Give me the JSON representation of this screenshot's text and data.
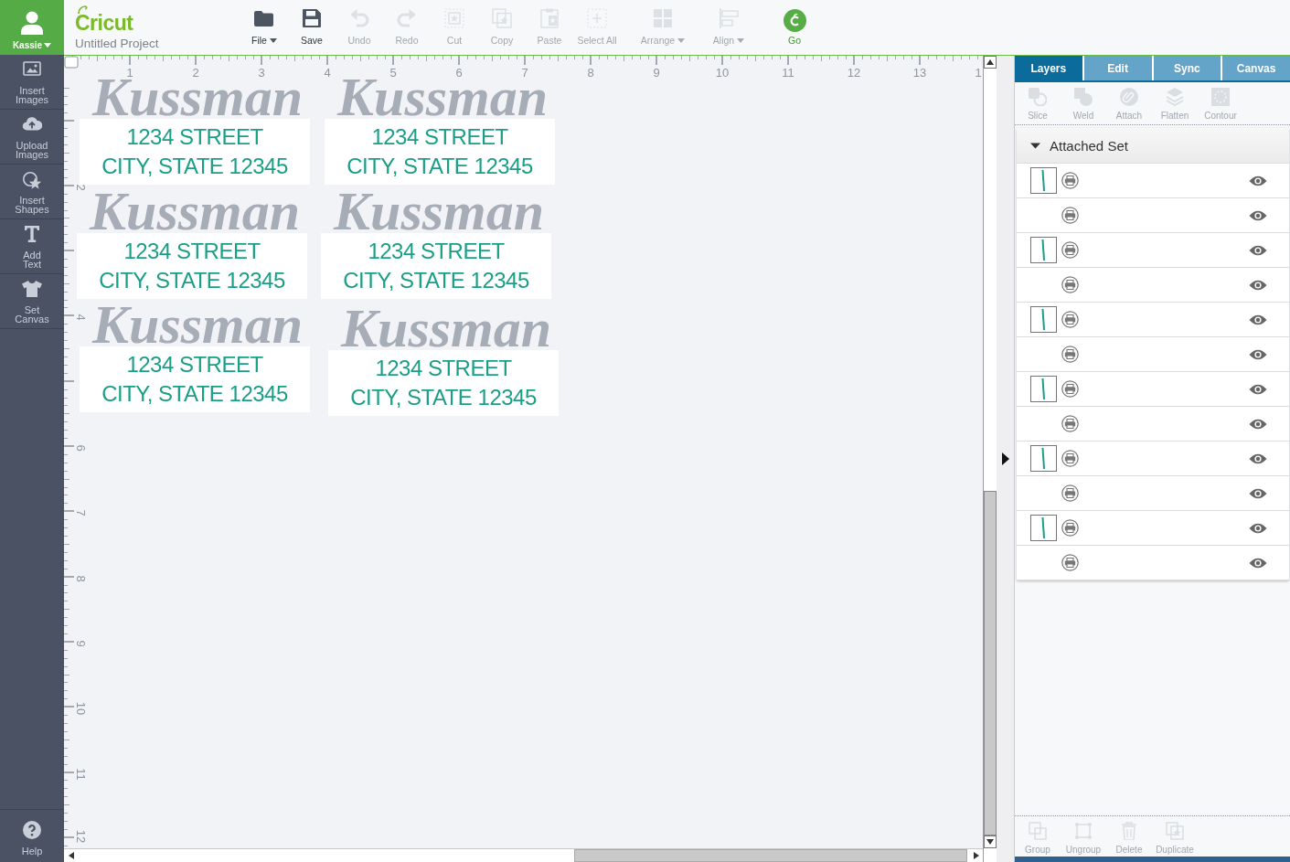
{
  "sidebar": {
    "user": {
      "name": "Kassie"
    },
    "items": [
      {
        "label": "Insert Images"
      },
      {
        "label": "Upload Images"
      },
      {
        "label": "Insert Shapes"
      },
      {
        "label": "Add Text"
      },
      {
        "label": "Set Canvas"
      }
    ],
    "help": {
      "label": "Help"
    }
  },
  "header": {
    "logo": "Cricut",
    "project": "Untitled Project",
    "toolbar": [
      {
        "label": "File",
        "kind": "tool",
        "disabled": false,
        "dropdown": true
      },
      {
        "label": "Save",
        "kind": "tool",
        "disabled": false,
        "dropdown": false
      },
      {
        "label": "Undo",
        "kind": "tool",
        "disabled": true,
        "dropdown": false
      },
      {
        "label": "Redo",
        "kind": "tool",
        "disabled": true,
        "dropdown": false
      },
      {
        "label": "Cut",
        "kind": "tool",
        "disabled": true,
        "dropdown": false
      },
      {
        "label": "Copy",
        "kind": "tool",
        "disabled": true,
        "dropdown": false
      },
      {
        "label": "Paste",
        "kind": "tool",
        "disabled": true,
        "dropdown": false
      },
      {
        "label": "Select All",
        "kind": "tool",
        "disabled": true,
        "dropdown": false
      },
      {
        "label": "Arrange",
        "kind": "tool",
        "disabled": true,
        "dropdown": true
      },
      {
        "label": "Align",
        "kind": "tool",
        "disabled": true,
        "dropdown": true
      },
      {
        "label": "Go",
        "kind": "go",
        "disabled": false,
        "dropdown": false
      }
    ]
  },
  "canvas": {
    "top_ruler": [
      "1",
      "2",
      "3",
      "4",
      "5",
      "6",
      "7",
      "8",
      "9",
      "10",
      "11",
      "12",
      "13",
      "1"
    ],
    "left_ruler": [
      "2",
      "4",
      "6",
      "7",
      "8",
      "9",
      "10",
      "11",
      "12"
    ],
    "designs": [
      {
        "name": "Kussman",
        "lines": [
          "1234 STREET",
          "CITY, STATE 12345"
        ]
      },
      {
        "name": "Kussman",
        "lines": [
          "1234 STREET",
          "CITY, STATE 12345"
        ]
      },
      {
        "name": "Kussman",
        "lines": [
          "1234 STREET",
          "CITY, STATE 12345"
        ]
      },
      {
        "name": "Kussman",
        "lines": [
          "1234 STREET",
          "CITY, STATE 12345"
        ]
      },
      {
        "name": "Kussman",
        "lines": [
          "1234 STREET",
          "CITY, STATE 12345"
        ]
      },
      {
        "name": "Kussman",
        "lines": [
          "1234 STREET",
          "CITY, STATE 12345"
        ]
      }
    ]
  },
  "panel": {
    "tabs": [
      {
        "label": "Layers",
        "selected": true
      },
      {
        "label": "Edit",
        "selected": false
      },
      {
        "label": "Sync",
        "selected": false
      },
      {
        "label": "Canvas",
        "selected": false
      }
    ],
    "tools": [
      {
        "label": "Slice",
        "disabled": true
      },
      {
        "label": "Weld",
        "disabled": true
      },
      {
        "label": "Attach",
        "disabled": true
      },
      {
        "label": "Flatten",
        "disabled": true
      },
      {
        "label": "Contour",
        "disabled": true
      }
    ],
    "layers": {
      "title": "Attached Set",
      "expanded": true,
      "rows": [
        {
          "kind": "thumbnail",
          "visible": true
        },
        {
          "kind": "plain",
          "visible": true
        },
        {
          "kind": "thumbnail",
          "visible": true
        },
        {
          "kind": "plain",
          "visible": true
        },
        {
          "kind": "thumbnail",
          "visible": true
        },
        {
          "kind": "plain",
          "visible": true
        },
        {
          "kind": "thumbnail",
          "visible": true
        },
        {
          "kind": "plain",
          "visible": true
        },
        {
          "kind": "thumbnail",
          "visible": true
        },
        {
          "kind": "plain",
          "visible": true
        },
        {
          "kind": "thumbnail",
          "visible": true
        },
        {
          "kind": "plain",
          "visible": true
        }
      ]
    },
    "bottom_tools": [
      {
        "label": "Group",
        "disabled": true
      },
      {
        "label": "Ungroup",
        "disabled": true
      },
      {
        "label": "Delete",
        "disabled": true
      },
      {
        "label": "Duplicate",
        "disabled": true
      }
    ]
  }
}
